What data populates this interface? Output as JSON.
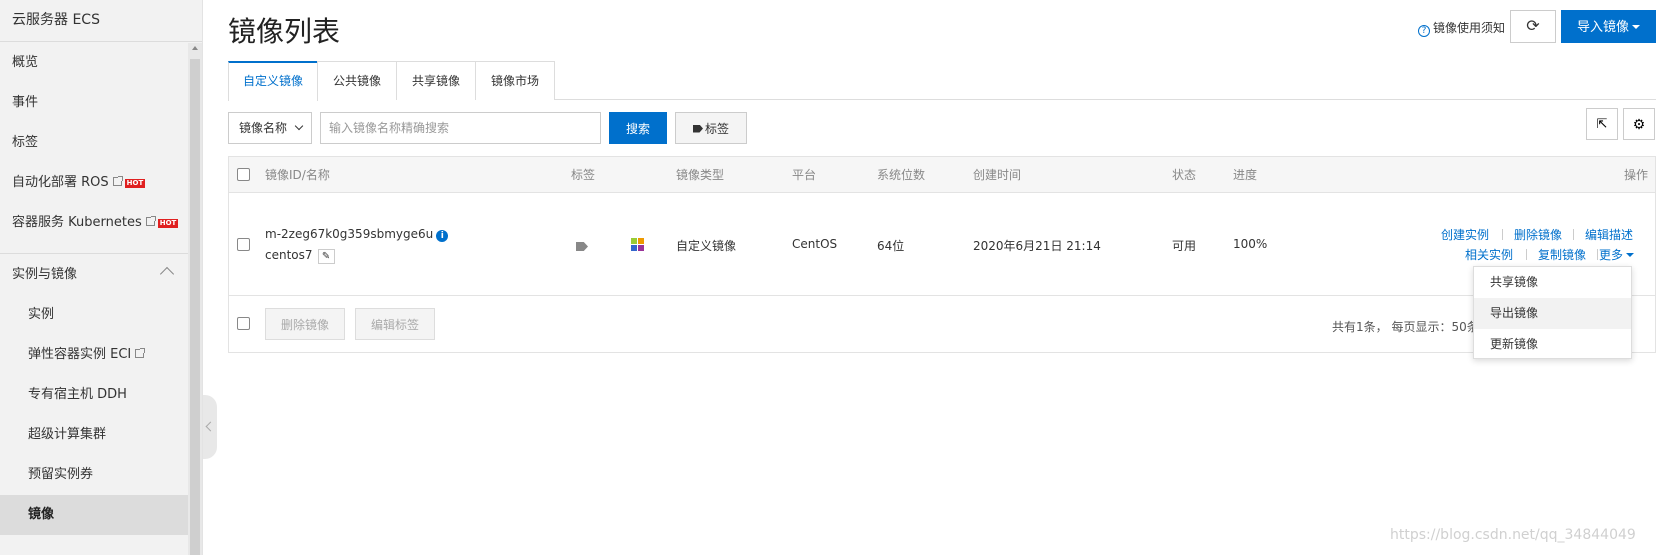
{
  "sidebar": {
    "title": "云服务器 ECS",
    "top_items": [
      {
        "label": "概览"
      },
      {
        "label": "事件"
      },
      {
        "label": "标签"
      }
    ],
    "ros": {
      "label": "自动化部署 ROS",
      "badge": "HOT"
    },
    "k8s": {
      "label": "容器服务 Kubernetes",
      "badge": "HOT"
    },
    "section": {
      "label": "实例与镜像",
      "expanded": true
    },
    "sub_items": [
      {
        "label": "实例"
      },
      {
        "label": "弹性容器实例 ECI"
      },
      {
        "label": "专有宿主机 DDH"
      },
      {
        "label": "超级计算集群"
      },
      {
        "label": "预留实例券"
      },
      {
        "label": "镜像",
        "active": true
      }
    ]
  },
  "header": {
    "title": "镜像列表",
    "notice": "镜像使用须知",
    "refresh_icon": "refresh-icon",
    "import_button": "导入镜像"
  },
  "tabs": [
    {
      "label": "自定义镜像",
      "active": true
    },
    {
      "label": "公共镜像"
    },
    {
      "label": "共享镜像"
    },
    {
      "label": "镜像市场"
    }
  ],
  "filter": {
    "select_value": "镜像名称",
    "search_placeholder": "输入镜像名称精确搜索",
    "search_button": "搜索",
    "tag_button": "标签"
  },
  "table": {
    "columns": [
      "镜像ID/名称",
      "标签",
      "镜像类型",
      "平台",
      "系统位数",
      "创建时间",
      "状态",
      "进度",
      "操作"
    ],
    "rows": [
      {
        "id": "m-2zeg67k0g359sbmyge6u",
        "name": "centos7",
        "type": "自定义镜像",
        "platform": "CentOS",
        "bits": "64位",
        "created": "2020年6月21日 21:14",
        "status": "可用",
        "progress": "100%",
        "actions": {
          "create_instance": "创建实例",
          "delete_image": "删除镜像",
          "edit_desc": "编辑描述",
          "related_instances": "相关实例",
          "copy_image": "复制镜像",
          "more": "更多"
        }
      }
    ],
    "footer": {
      "delete_button": "删除镜像",
      "edit_tags_button": "编辑标签",
      "summary": "共有1条， 每页显示：50条"
    }
  },
  "more_menu": [
    {
      "label": "共享镜像"
    },
    {
      "label": "导出镜像",
      "hover": true
    },
    {
      "label": "更新镜像"
    }
  ],
  "watermark": "https://blog.csdn.net/qq_34844049",
  "colors": {
    "accent": "#0070cc",
    "hot": "#e02020",
    "sidebar_bg": "#f2f2f2"
  }
}
